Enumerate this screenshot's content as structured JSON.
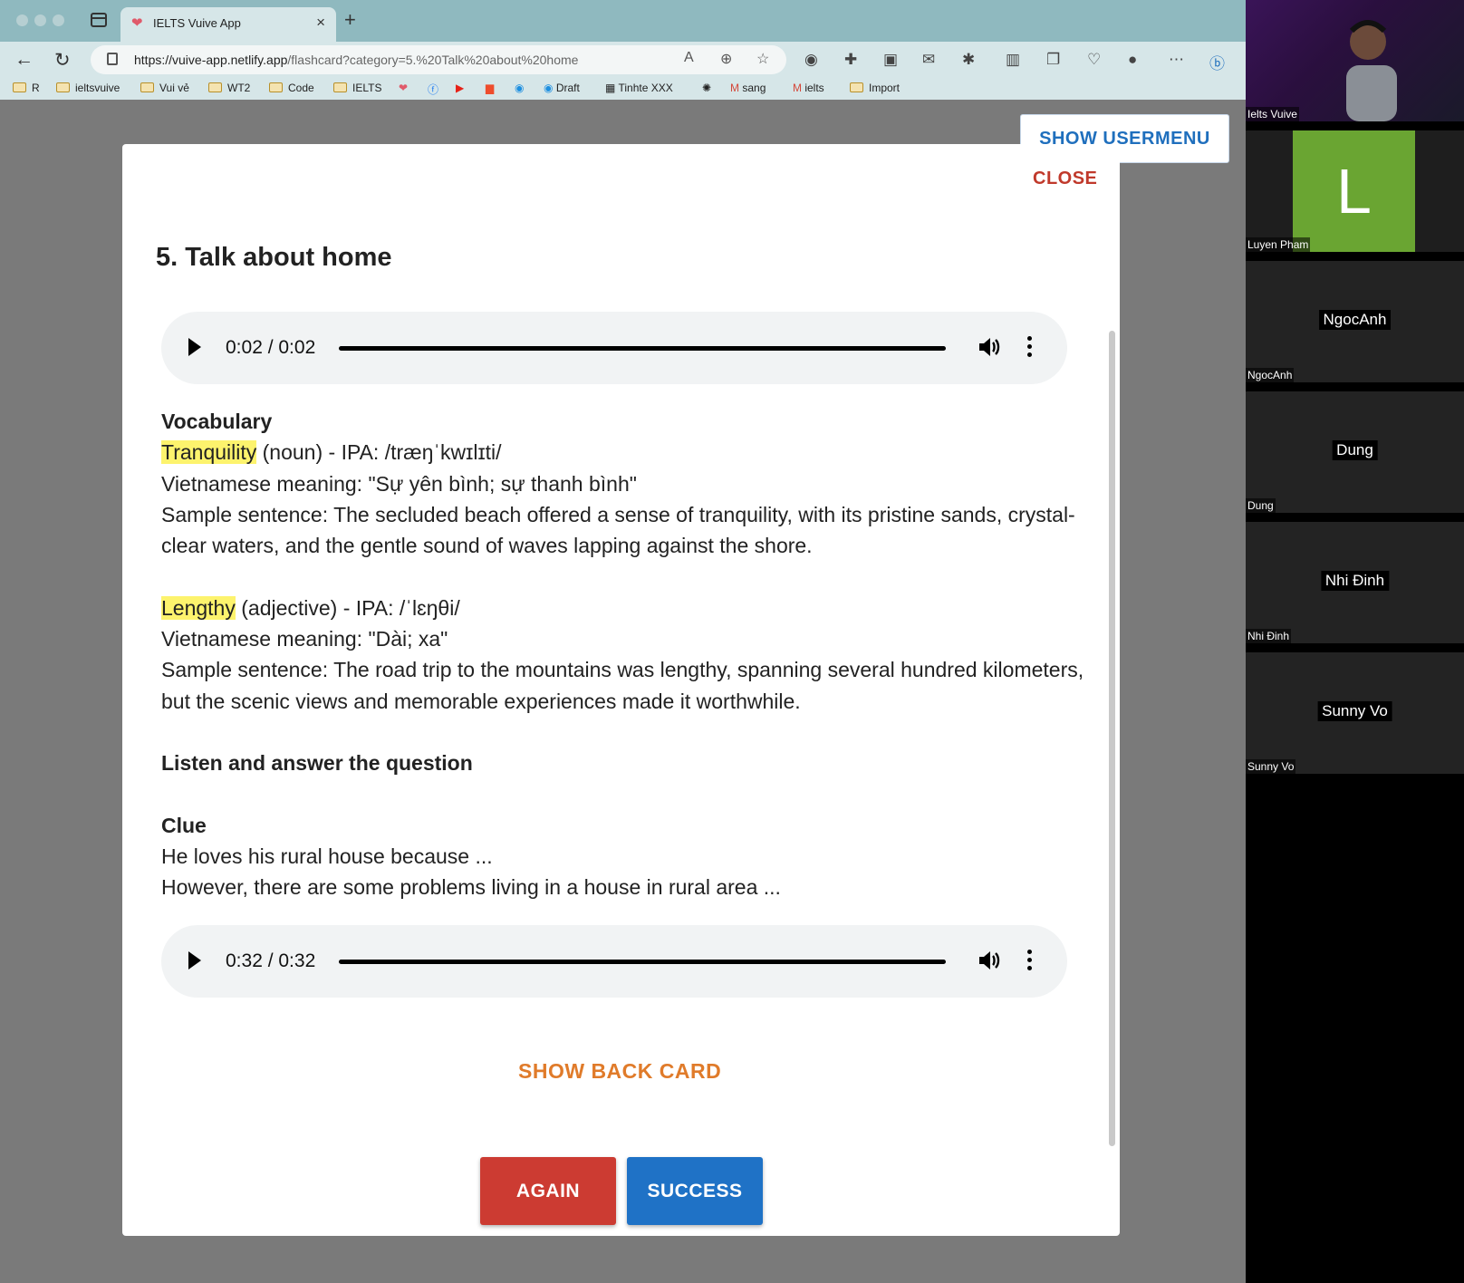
{
  "browser": {
    "tab_title": "IELTS Vuive App",
    "url_host": "https://vuive-app.netlify.app",
    "url_path": "/flashcard?category=5.%20Talk%20about%20home",
    "bookmarks": [
      "R",
      "ieltsvuive",
      "Vui vẻ",
      "WT2",
      "Code",
      "IELTS",
      "Draft",
      "Tinhte XXX",
      "sang",
      "ielts",
      "Import"
    ]
  },
  "header": {
    "usermenu_label": "SHOW USERMENU"
  },
  "modal": {
    "close_label": "CLOSE",
    "title": "5. Talk about home",
    "audio1": {
      "time": "0:02 / 0:02",
      "progress": 1.0
    },
    "audio2": {
      "time": "0:32 / 0:32",
      "progress": 1.0
    },
    "vocab_heading": "Vocabulary",
    "word1": {
      "term": "Tranquility",
      "ipa": " (noun) - IPA: /træŋˈkwɪlɪti/",
      "meaning": "Vietnamese meaning: \"Sự yên bình; sự thanh bình\"",
      "sample": "Sample sentence: The secluded beach offered a sense of tranquility, with its pristine sands, crystal-clear waters, and the gentle sound of waves lapping against the shore."
    },
    "word2": {
      "term": "Lengthy",
      "ipa": " (adjective) - IPA: /ˈlɛŋθi/",
      "meaning": "Vietnamese meaning: \"Dài; xa\"",
      "sample": "Sample sentence: The road trip to the mountains was lengthy, spanning several hundred kilometers, but the scenic views and memorable experiences made it worthwhile."
    },
    "listen_heading": "Listen and answer the question",
    "clue_heading": "Clue",
    "clue_line1": "He loves his rural house because ...",
    "clue_line2": "However, there are some problems living in a house in rural area ...",
    "show_back_label": "SHOW BACK CARD",
    "again_label": "AGAIN",
    "success_label": "SUCCESS"
  },
  "participants": [
    {
      "label": "Ielts Vuive",
      "video": true
    },
    {
      "label": "Luyen Pham",
      "avatar_letter": "L"
    },
    {
      "label": "NgocAnh",
      "name": "NgocAnh"
    },
    {
      "label": "Dung",
      "name": "Dung"
    },
    {
      "label": "Nhi Đinh",
      "name": "Nhi Đinh"
    },
    {
      "label": "Sunny Vo",
      "name": "Sunny Vo"
    }
  ],
  "colors": {
    "again": "#cc3b32",
    "success": "#1f72c6",
    "show_back": "#e07b2a",
    "close": "#c0392b",
    "usermenu": "#1f6fbd",
    "highlight": "#fdf36d"
  }
}
